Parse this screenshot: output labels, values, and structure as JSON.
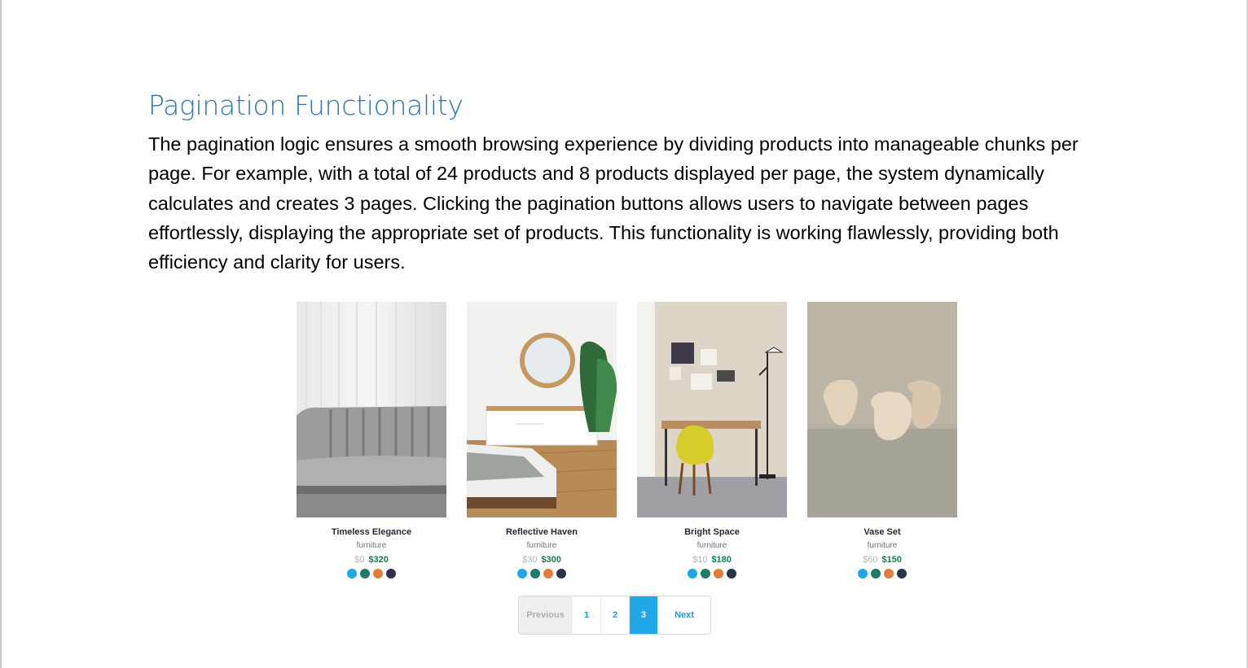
{
  "document": {
    "heading": "Pagination Functionality",
    "paragraph": "The pagination logic ensures a smooth browsing experience by dividing products into manageable chunks per page. For example, with a total of 24 products and 8 products displayed per page, the system dynamically calculates and creates 3 pages. Clicking the pagination buttons allows users to navigate between pages effortlessly, displaying the appropriate set of products. This functionality is working flawlessly, providing both efficiency and clarity for users."
  },
  "products": [
    {
      "name": "Timeless Elegance",
      "category": "furniture",
      "old_price": "$0",
      "price": "$320",
      "image": "grey-sofa-photo"
    },
    {
      "name": "Reflective Haven",
      "category": "furniture",
      "old_price": "$30",
      "price": "$300",
      "image": "bedroom-mirror-dresser-photo"
    },
    {
      "name": "Bright Space",
      "category": "furniture",
      "old_price": "$10",
      "price": "$180",
      "image": "desk-yellow-chair-photo"
    },
    {
      "name": "Vase Set",
      "category": "furniture",
      "old_price": "$60",
      "price": "$150",
      "image": "ceramic-vases-photo"
    }
  ],
  "swatch_colors": [
    "#1ea8e8",
    "#1f7a66",
    "#e67a3b",
    "#2a3347"
  ],
  "pagination": {
    "previous": "Previous",
    "pages": [
      "1",
      "2",
      "3"
    ],
    "active_page": "3",
    "next": "Next"
  },
  "colors": {
    "heading": "#2e74b5",
    "price": "#127c52",
    "active_page": "#22a7e8"
  }
}
